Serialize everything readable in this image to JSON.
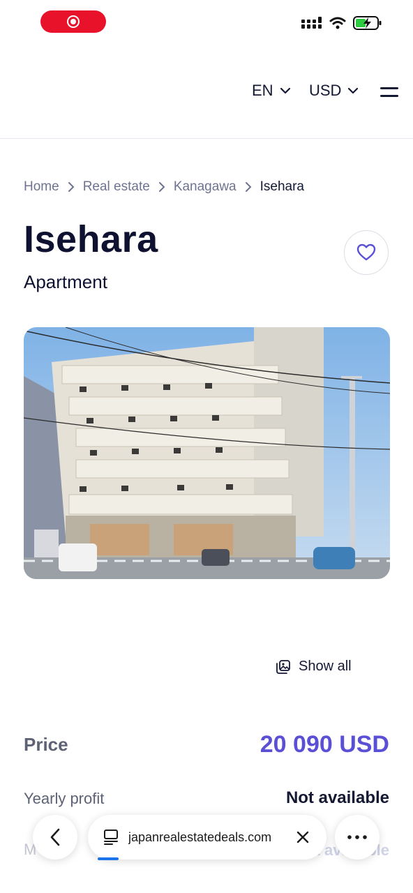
{
  "header": {
    "language": "EN",
    "currency": "USD"
  },
  "breadcrumb": {
    "items": [
      "Home",
      "Real estate",
      "Kanagawa",
      "Isehara"
    ]
  },
  "listing": {
    "title": "Isehara",
    "type": "Apartment",
    "show_all_label": "Show all",
    "price_label": "Price",
    "price_value": "20 090 USD",
    "yearly_profit_label": "Yearly profit",
    "yearly_profit_value": "Not available",
    "monthly_label_partial": "M",
    "monthly_value_partial": "Not available"
  },
  "browser": {
    "url": "japanrealestatedeals.com"
  },
  "colors": {
    "accent": "#5b4fd6",
    "record": "#e8132b",
    "text_dark": "#0e1230"
  },
  "icons": [
    "record-icon",
    "signal-icon",
    "wifi-icon",
    "battery-charging-icon",
    "chevron-down-icon",
    "menu-icon",
    "chevron-right-icon",
    "heart-icon",
    "gallery-icon",
    "back-arrow-icon",
    "tabs-icon",
    "close-icon",
    "more-icon"
  ]
}
